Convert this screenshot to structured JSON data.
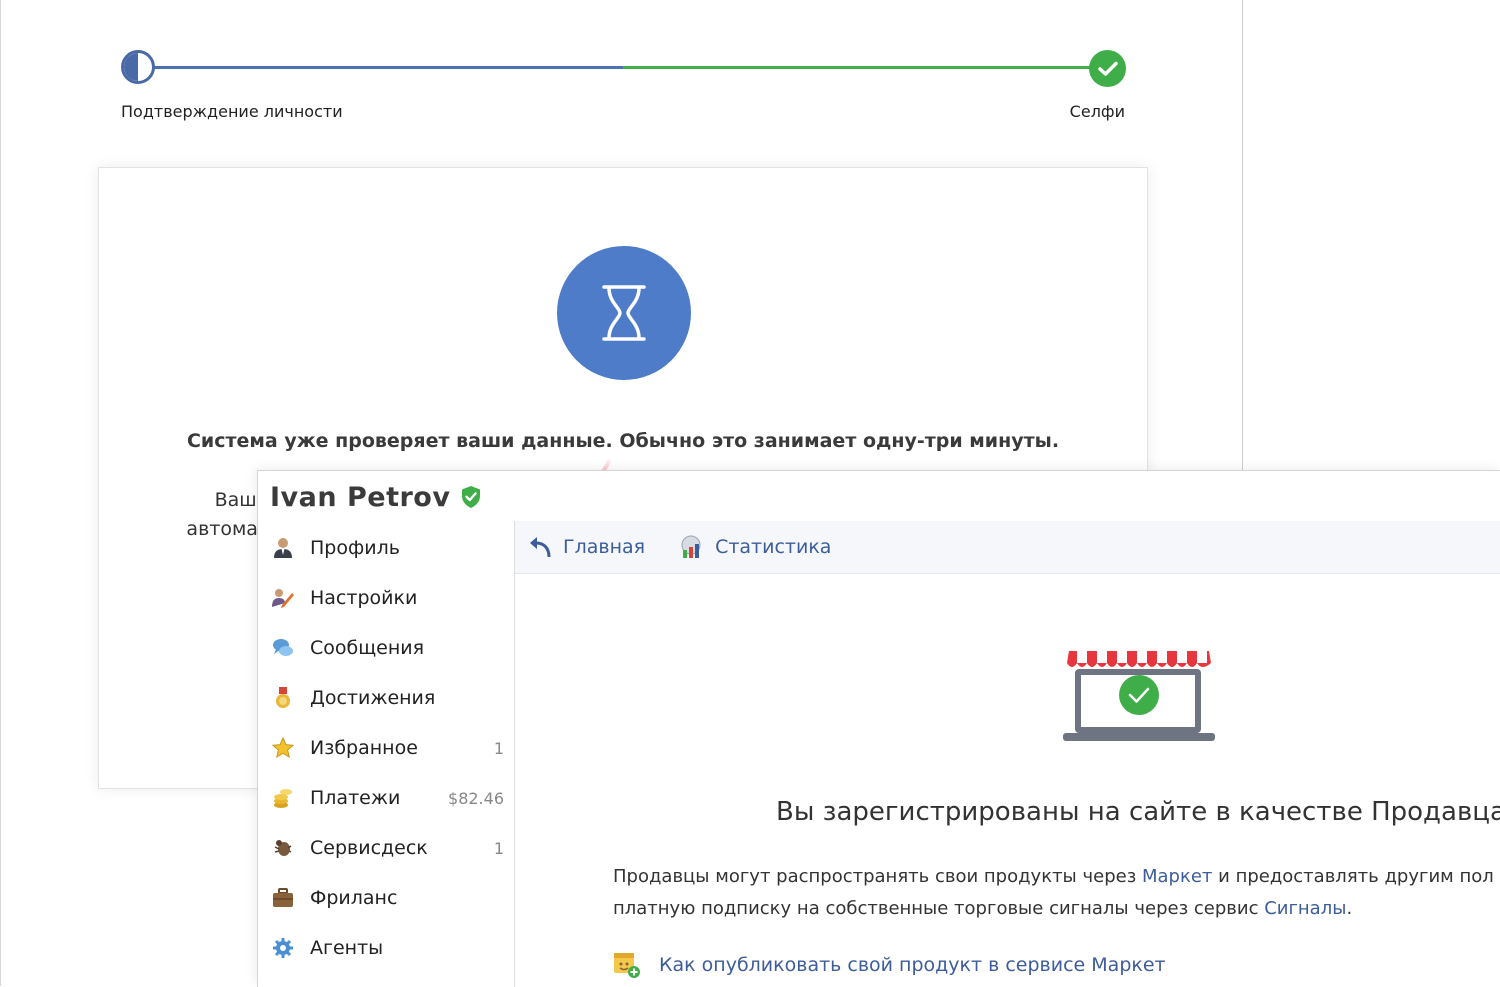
{
  "steps": {
    "step1_label": "Подтверждение личности",
    "step2_label": "Селфи"
  },
  "card": {
    "status_text": "Система уже проверяет ваши данные. Обычно это занимает одну-три минуты.",
    "partial_line1": "Ваши",
    "partial_line2": "автомат"
  },
  "user": {
    "name": "Ivan Petrov",
    "verified_icon": "shield-check-icon"
  },
  "sidebar": {
    "items": [
      {
        "label": "Профиль",
        "icon": "profile-icon",
        "count": ""
      },
      {
        "label": "Настройки",
        "icon": "settings-icon",
        "count": ""
      },
      {
        "label": "Сообщения",
        "icon": "messages-icon",
        "count": ""
      },
      {
        "label": "Достижения",
        "icon": "medal-icon",
        "count": ""
      },
      {
        "label": "Избранное",
        "icon": "star-icon",
        "count": "1"
      },
      {
        "label": "Платежи",
        "icon": "coins-icon",
        "count": "$82.46"
      },
      {
        "label": "Сервисдеск",
        "icon": "bug-icon",
        "count": "1"
      },
      {
        "label": "Фриланс",
        "icon": "briefcase-icon",
        "count": ""
      },
      {
        "label": "Агенты",
        "icon": "gear-icon",
        "count": ""
      }
    ]
  },
  "nav": {
    "home_label": "Главная",
    "stats_label": "Статистика"
  },
  "seller": {
    "title": "Вы зарегистрированы на сайте в качестве Продавца.",
    "desc_part1": "Продавцы могут распространять свои продукты через ",
    "market_link": "Маркет",
    "desc_part2": " и предоставлять другим пол",
    "desc_part3": "платную подписку на собственные торговые сигналы через сервис ",
    "signals_link": "Сигналы",
    "desc_part4": ".",
    "help_link": "Как опубликовать свой продукт в сервисе Маркет"
  },
  "colors": {
    "accent_blue": "#4e7cc8",
    "success_green": "#3fae49",
    "link_blue": "#3d5d9a",
    "arrow_red": "#e8363f"
  }
}
